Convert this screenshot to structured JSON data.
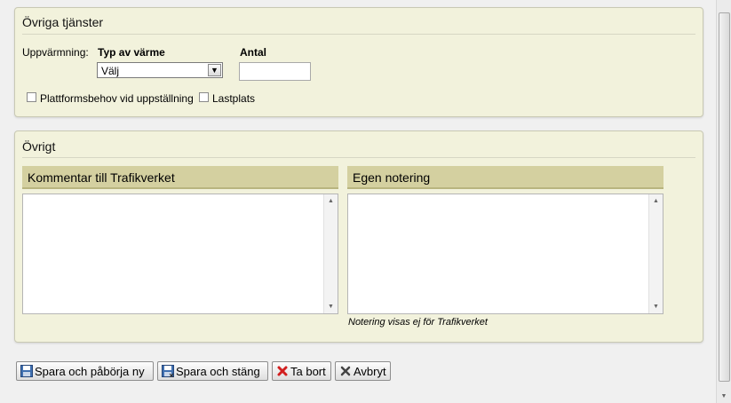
{
  "services_panel": {
    "title": "Övriga tjänster",
    "heating_label": "Uppvärmning:",
    "heat_type_header": "Typ av värme",
    "heat_type_value": "Välj",
    "count_header": "Antal",
    "count_value": "",
    "platform_label": "Plattformsbehov vid uppställning",
    "cargo_label": "Lastplats"
  },
  "other_panel": {
    "title": "Övrigt",
    "comment_header": "Kommentar till Trafikverket",
    "comment_value": "",
    "note_header": "Egen notering",
    "note_value": "",
    "note_hint": "Notering visas ej för Trafikverket"
  },
  "buttons": {
    "save_new": "Spara och påbörja ny",
    "save_close": "Spara och stäng",
    "delete": "Ta bort",
    "cancel": "Avbryt"
  }
}
